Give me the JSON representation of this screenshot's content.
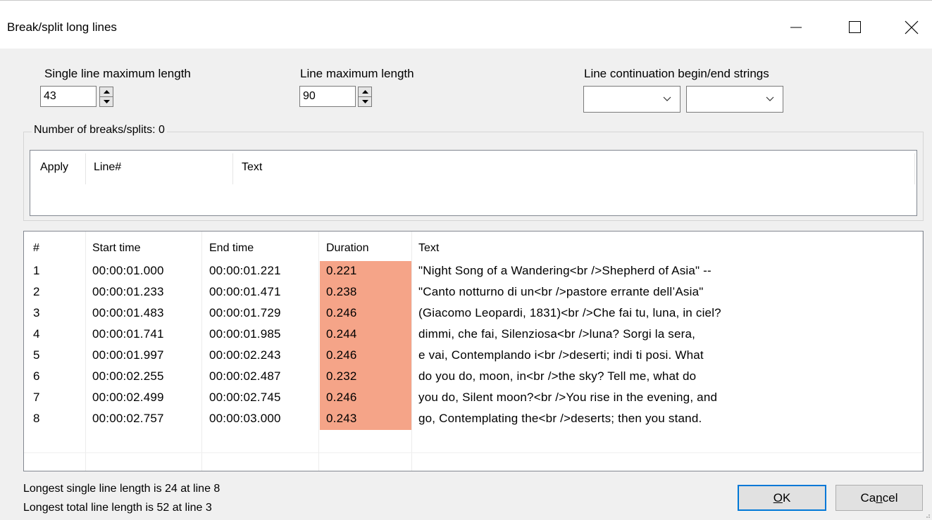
{
  "window": {
    "title": "Break/split long lines"
  },
  "settings": {
    "single_line_label": "Single line maximum length",
    "single_line_value": "43",
    "line_max_label": "Line maximum length",
    "line_max_value": "90",
    "continuation_label": "Line continuation begin/end strings",
    "continuation_begin": "",
    "continuation_end": ""
  },
  "breaks": {
    "count_label": "Number of breaks/splits: 0",
    "columns": [
      "Apply",
      "Line#",
      "Text"
    ]
  },
  "grid": {
    "columns": [
      "#",
      "Start time",
      "End time",
      "Duration",
      "Text"
    ],
    "rows": [
      [
        "1",
        "00:00:01.000",
        "00:00:01.221",
        "0.221",
        "\"Night Song of a Wandering<br />Shepherd of Asia\" --"
      ],
      [
        "2",
        "00:00:01.233",
        "00:00:01.471",
        "0.238",
        "\"Canto notturno di un<br />pastore errante dell’Asia\""
      ],
      [
        "3",
        "00:00:01.483",
        "00:00:01.729",
        "0.246",
        "(Giacomo Leopardi, 1831)<br />Che fai tu, luna, in ciel?"
      ],
      [
        "4",
        "00:00:01.741",
        "00:00:01.985",
        "0.244",
        "dimmi, che fai, Silenziosa<br />luna? Sorgi la sera,"
      ],
      [
        "5",
        "00:00:01.997",
        "00:00:02.243",
        "0.246",
        "e vai, Contemplando i<br />deserti; indi ti posi.  What"
      ],
      [
        "6",
        "00:00:02.255",
        "00:00:02.487",
        "0.232",
        "do you do, moon, in<br />the sky? Tell me, what do"
      ],
      [
        "7",
        "00:00:02.499",
        "00:00:02.745",
        "0.246",
        "you do, Silent moon?<br />You rise in the evening, and"
      ],
      [
        "8",
        "00:00:02.757",
        "00:00:03.000",
        "0.243",
        "go, Contemplating the<br />deserts; then you stand."
      ]
    ],
    "duration_highlight_color": "#f5a488"
  },
  "status": {
    "longest_single": "Longest single line length is 24 at line 8",
    "longest_total": "Longest total line length is 52 at line 3"
  },
  "buttons": {
    "ok_prefix": "",
    "ok_mnemonic": "O",
    "ok_rest": "K",
    "cancel_prefix": "Ca",
    "cancel_mnemonic": "n",
    "cancel_rest": "cel"
  },
  "icons": {
    "minimize": "minimize-icon",
    "maximize": "maximize-icon",
    "close": "close-icon",
    "spin_up": "spin-up-icon",
    "spin_down": "spin-down-icon",
    "chevron": "chevron-down-icon"
  }
}
